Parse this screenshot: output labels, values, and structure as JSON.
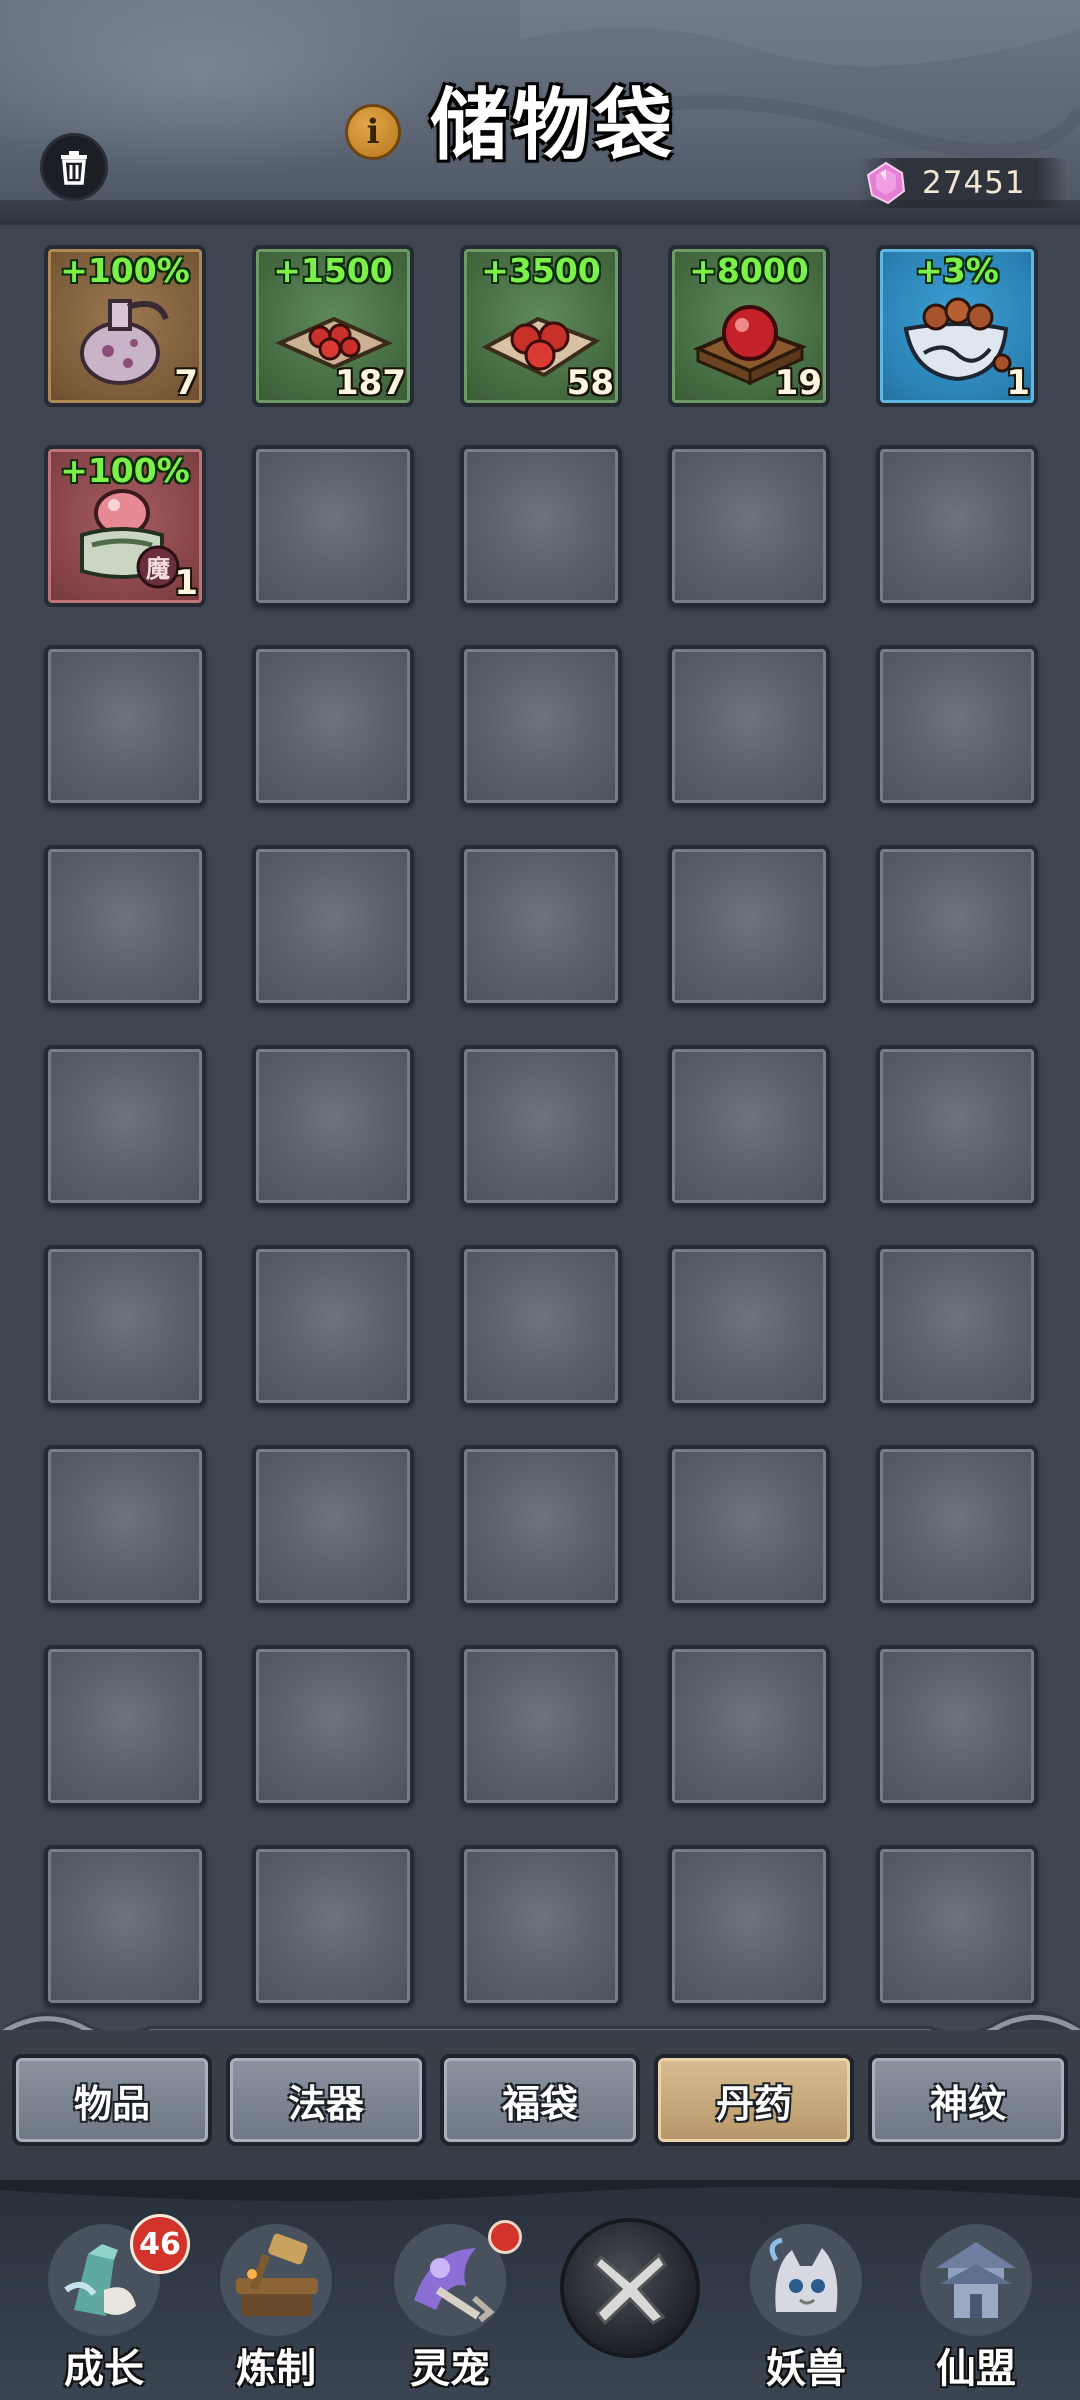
{
  "header": {
    "title": "储物袋",
    "info_icon_glyph": "i",
    "currency": {
      "icon": "pink-gem-icon",
      "value": "27451"
    }
  },
  "grid": {
    "items": [
      {
        "bonus": "+100%",
        "count": "7",
        "icon": "potion-vase-icon",
        "rarity": "brown"
      },
      {
        "bonus": "+1500",
        "count": "187",
        "icon": "red-pills-small-icon",
        "rarity": "green"
      },
      {
        "bonus": "+3500",
        "count": "58",
        "icon": "red-pills-large-icon",
        "rarity": "green"
      },
      {
        "bonus": "+8000",
        "count": "19",
        "icon": "red-orb-box-icon",
        "rarity": "green"
      },
      {
        "bonus": "+3%",
        "count": "1",
        "icon": "pill-bowl-icon",
        "rarity": "blue"
      },
      {
        "bonus": "+100%",
        "count": "1",
        "icon": "demon-pill-jar-icon",
        "rarity": "red",
        "tag": "魔"
      }
    ],
    "empty_slots": 39
  },
  "tabs": [
    {
      "label": "物品",
      "active": false
    },
    {
      "label": "法器",
      "active": false
    },
    {
      "label": "福袋",
      "active": false
    },
    {
      "label": "丹药",
      "active": true
    },
    {
      "label": "神纹",
      "active": false
    }
  ],
  "nav": {
    "items": [
      {
        "label": "成长",
        "icon": "growth-icon",
        "badge": "46"
      },
      {
        "label": "炼制",
        "icon": "forge-anvil-icon",
        "dot": true
      },
      {
        "label": "灵宠",
        "icon": "spirit-pet-icon",
        "dot": true
      },
      {
        "label": "妖兽",
        "icon": "demon-beast-icon"
      },
      {
        "label": "仙盟",
        "icon": "immortal-alliance-icon"
      }
    ],
    "close_icon": "close-x-icon"
  },
  "colors": {
    "bonus_green": "#7cf14a",
    "badge_red": "#d2332a",
    "active_tab": "#d9bd92",
    "background": "#3f4650"
  }
}
